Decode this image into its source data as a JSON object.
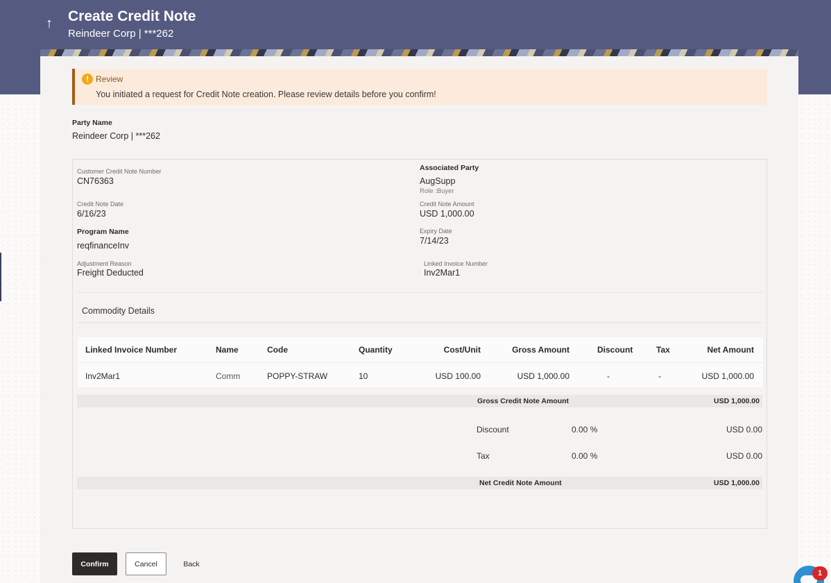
{
  "header": {
    "title": "Create Credit Note",
    "subtitle": "Reindeer Corp | ***262",
    "back_icon": "up-arrow-icon"
  },
  "alert": {
    "title": "Review",
    "message": "You initiated a request for Credit Note creation. Please review details before you confirm!",
    "icon": "info-icon",
    "icon_glyph": "!"
  },
  "party": {
    "label": "Party Name",
    "value": "Reindeer Corp | ***262"
  },
  "details": {
    "customer_credit_note_number": {
      "label": "Customer Credit Note Number",
      "value": "CN76363"
    },
    "associated_party": {
      "label": "Associated Party",
      "value": "AugSupp",
      "role": "Role :Buyer"
    },
    "credit_note_date": {
      "label": "Credit Note Date",
      "value": "6/16/23"
    },
    "credit_note_amount": {
      "label": "Credit Note Amount",
      "value": "USD 1,000.00"
    },
    "program_name": {
      "label": "Program Name",
      "value": "reqfinanceInv"
    },
    "expiry_date": {
      "label": "Expiry Date",
      "value": "7/14/23"
    },
    "adjustment_reason": {
      "label": "Adjustment Reason",
      "value": "Freight Deducted"
    },
    "linked_invoice_number": {
      "label": "Linked Invoice Number",
      "value": "Inv2Mar1"
    }
  },
  "commodity": {
    "section_title": "Commodity Details",
    "columns": [
      "Linked Invoice Number",
      "Name",
      "Code",
      "Quantity",
      "Cost/Unit",
      "Gross Amount",
      "Discount",
      "Tax",
      "Net Amount"
    ],
    "rows": [
      [
        "Inv2Mar1",
        "Comm",
        "POPPY-STRAW",
        "10",
        "USD 100.00",
        "USD 1,000.00",
        "-",
        "-",
        "USD 1,000.00"
      ]
    ]
  },
  "summary": {
    "gross_label": "Gross Credit Note Amount",
    "gross_value": "USD 1,000.00",
    "discount_label": "Discount",
    "discount_pct": "0.00 %",
    "discount_value": "USD 0.00",
    "tax_label": "Tax",
    "tax_pct": "0.00 %",
    "tax_value": "USD 0.00",
    "net_label": "Net Credit Note Amount",
    "net_value": "USD 1,000.00"
  },
  "actions": {
    "confirm": "Confirm",
    "cancel": "Cancel",
    "back": "Back"
  },
  "chat": {
    "badge_count": "1",
    "icon": "chat-icon"
  },
  "colors": {
    "header_bg": "#555a80",
    "alert_bg": "#fcebdc",
    "alert_border": "#a45c12",
    "confirm_bg": "#2e2b28",
    "badge_bg": "#d62828"
  }
}
